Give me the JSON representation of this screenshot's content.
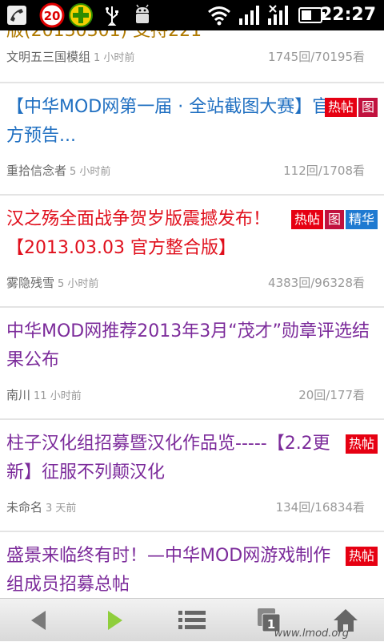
{
  "status_bar": {
    "time": "22:27",
    "notification_count": "20",
    "icons": [
      "missed-call-icon",
      "notification-badge-icon",
      "add-icon",
      "usb-icon",
      "android-debug-icon",
      "wifi-icon",
      "signal-icon",
      "signal-3g-icon",
      "battery-icon"
    ]
  },
  "partial_top": {
    "title_fragment": "版(20130301) 支持221",
    "author": "文明五三国模组",
    "ago": "1 小时前",
    "stats": "1745回/70195看"
  },
  "threads": [
    {
      "title": "【中华MOD网第一届 · 全站截图大赛】官方预告...",
      "color": "#1f6fc1",
      "badges": [
        "热帖",
        "图"
      ],
      "author": "重拾信念者",
      "ago": "5 小时前",
      "stats": "112回/1708看"
    },
    {
      "title": "汉之殇全面战争贺岁版震撼发布！【2013.03.03 官方整合版】",
      "color": "#e00f1c",
      "badges": [
        "热帖",
        "图",
        "精华"
      ],
      "author": "雾隐残雪",
      "ago": "5 小时前",
      "stats": "4383回/96328看"
    },
    {
      "title": "中华MOD网推荐2013年3月“茂才”勋章评选结果公布",
      "color": "#7b2a9a",
      "badges": [],
      "author": "南川",
      "ago": "11 小时前",
      "stats": "20回/177看"
    },
    {
      "title": "柱子汉化组招募暨汉化作品览-----【2.2更新】征服不列颠汉化",
      "color": "#7b2a9a",
      "badges": [
        "热帖"
      ],
      "author": "未命名",
      "ago": "3 天前",
      "stats": "134回/16834看"
    },
    {
      "title": "盛景来临终有时！—中华MOD网游戏制作组成员招募总帖",
      "color": "#7b2a9a",
      "badges": [
        "热帖"
      ],
      "author": "",
      "ago": "",
      "stats": ""
    }
  ],
  "nav": {
    "items": [
      "back-arrow-icon",
      "forward-arrow-icon",
      "menu-list-icon",
      "tabs-icon",
      "home-icon"
    ],
    "tab_count": "1",
    "watermark": "www.lmod.org"
  }
}
